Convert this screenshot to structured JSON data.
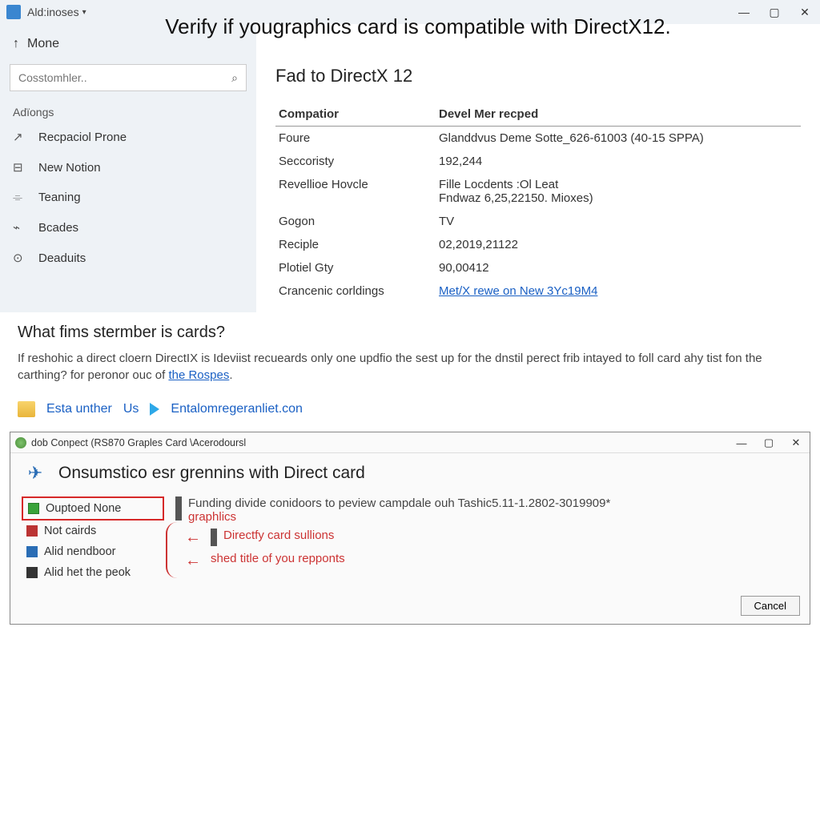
{
  "topbar": {
    "title": "Ald:inoses",
    "caret": "▾"
  },
  "overlay_title": "Verify if yougraphics card is compatible with DirectX12.",
  "win": {
    "min": "—",
    "max": "▢",
    "close": "✕"
  },
  "sidebar": {
    "home_label": "Mone",
    "search_placeholder": "Cosstomhler..",
    "section": "Adïongs",
    "items": [
      {
        "icon": "↗",
        "label": "Recpaciol Prone"
      },
      {
        "icon": "⊟",
        "label": "New Notion"
      },
      {
        "icon": "⌯",
        "label": "Teaning"
      },
      {
        "icon": "⌁",
        "label": "Bcades"
      },
      {
        "icon": "⊙",
        "label": "Deaduits"
      }
    ]
  },
  "content": {
    "heading": "Fad to DirectX 12",
    "header1": "Compatior",
    "header2": "Devel Mer recped",
    "rows": [
      {
        "k": "Foure",
        "v": "Glanddvus Deme Sotte_626-61003 (40-15 SPPA)"
      },
      {
        "k": "Seccoristy",
        "v": "192,244"
      },
      {
        "k": "Revellioe Hovcle",
        "v": "Fille Locdents :Ol Leat\nFndwaz 6,25,22150. Mioxes)"
      },
      {
        "k": "Gogon",
        "v": "TV"
      },
      {
        "k": "Reciple",
        "v": "02,2019,21122"
      },
      {
        "k": "Plotiel Gty",
        "v": "90,00412"
      },
      {
        "k": "Crancenic corldings",
        "v": "Met/X rewe on New 3Yc19M4",
        "link": true
      }
    ]
  },
  "para": {
    "q": "What fims stermber is cards?",
    "body_a": "If reshohic a direct cloern DirectIX is Ideviist recueards only one updfio the sest up for the dnstil perect frib intayed to foll card ahy tist fon the carthing? for peronor ouc of ",
    "body_link": "the Rospes",
    "body_b": "."
  },
  "linkrow": {
    "a": "Esta unther",
    "b": "Us",
    "c": "Entalomregeranliet.con"
  },
  "tool": {
    "title": "dob Conpect (RS870 Graples Card \\Acerodoursl",
    "heading": "Onsumstico esr grennins with Direct card",
    "list": [
      {
        "color": "green",
        "label": "Ouptoed None",
        "selected": true
      },
      {
        "color": "red",
        "label": "Not cairds"
      },
      {
        "color": "blue",
        "label": "Alid nendboor"
      },
      {
        "color": "dark",
        "label": "Alid het the peok"
      }
    ],
    "desc_main": "Funding divide conidoors to peview campdale ouh Tashic5.11-1.2802-3019909*",
    "desc_main_b": "graphlics",
    "note1": "Directfy card sullions",
    "note2": "shed title of you repponts",
    "cancel": "Cancel"
  }
}
